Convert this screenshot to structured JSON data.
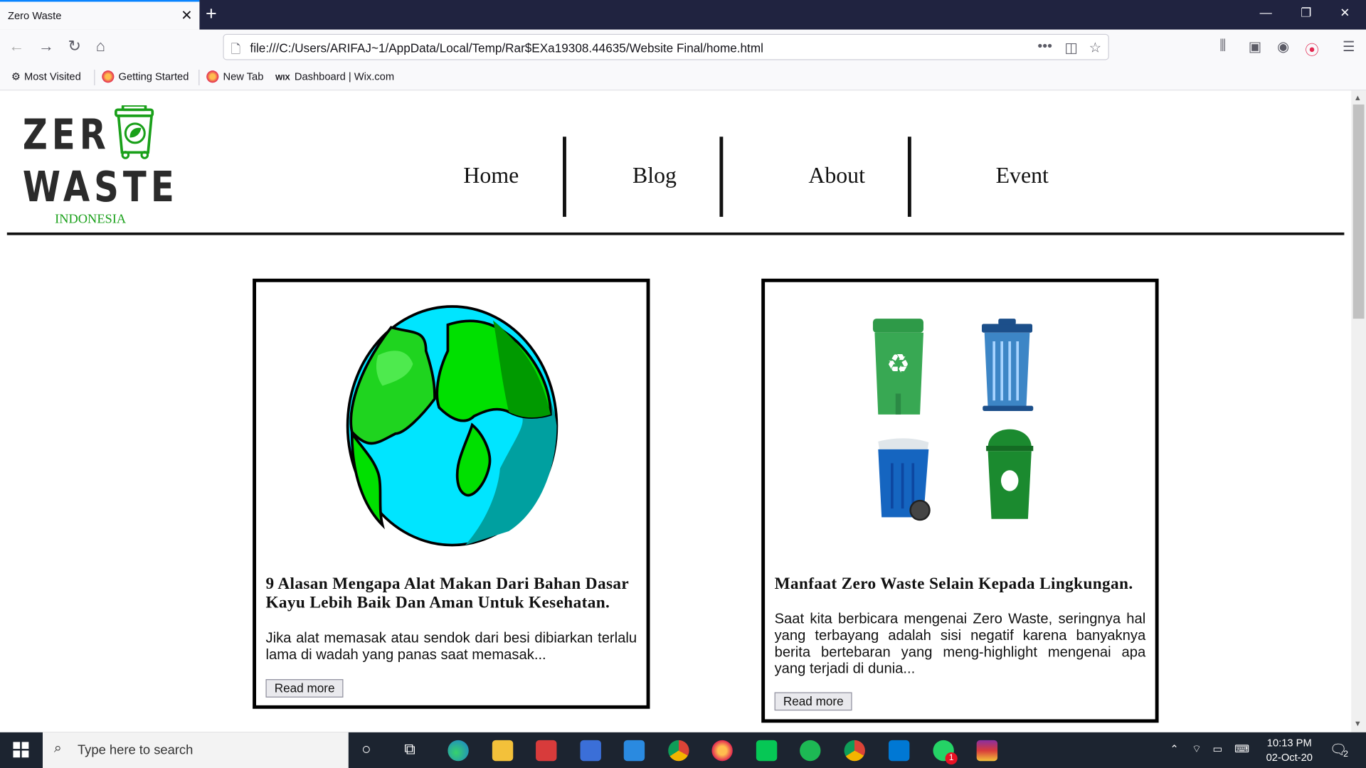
{
  "browser": {
    "tab_title": "Zero Waste",
    "url": "file:///C:/Users/ARIFAJ~1/AppData/Local/Temp/Rar$EXa19308.44635/Website Final/home.html",
    "bookmarks": [
      "Most Visited",
      "Getting Started",
      "New Tab",
      "Dashboard | Wix.com"
    ],
    "icons": {
      "back": "back-arrow-icon",
      "forward": "forward-arrow-icon",
      "reload": "reload-icon",
      "home": "home-icon",
      "page_actions": "more-icon",
      "pocket": "pocket-icon",
      "bookmark": "star-icon",
      "library": "library-icon",
      "sidebar": "sidebar-icon",
      "account": "account-icon",
      "record": "record-icon",
      "menu": "hamburger-icon"
    }
  },
  "site": {
    "logo": {
      "line1": "ZER",
      "line2": "WASTE",
      "sub": "INDONESIA",
      "accent_color": "#1aa01a"
    },
    "nav": [
      "Home",
      "Blog",
      "About",
      "Event"
    ]
  },
  "cards": [
    {
      "title": "9 Alasan Mengapa Alat Makan Dari Bahan Dasar Kayu Lebih Baik Dan Aman Untuk Kesehatan.",
      "excerpt": "Jika alat memasak atau sendok dari besi dibiarkan terlalu lama di wadah yang panas saat memasak...",
      "button": "Read more",
      "image": "earth-illustration"
    },
    {
      "title": "Manfaat Zero Waste Selain Kepada Lingkungan.",
      "excerpt": "Saat kita berbicara mengenai Zero Waste, seringnya hal yang terbayang adalah sisi negatif karena banyaknya berita bertebaran yang meng-highlight mengenai apa yang terjadi di dunia...",
      "button": "Read more",
      "image": "trash-bins-illustration"
    }
  ],
  "taskbar": {
    "search_placeholder": "Type here to search",
    "time": "10:13 PM",
    "date": "02-Oct-20",
    "notification_count": "2",
    "whatsapp_badge": "1"
  }
}
